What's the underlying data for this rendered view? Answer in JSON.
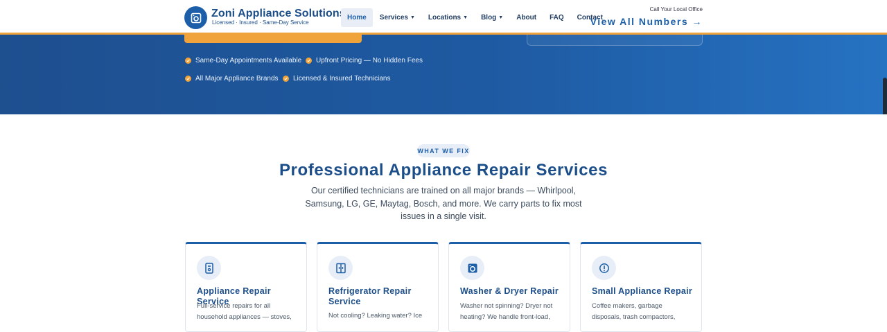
{
  "header": {
    "brand_name": "Zoni Appliance Solutions",
    "brand_tagline": "Licensed · Insured · Same-Day Service",
    "logo_icon": "washer-logo-icon",
    "nav": [
      {
        "label": "Home",
        "active": true,
        "has_caret": false
      },
      {
        "label": "Services",
        "active": false,
        "has_caret": true
      },
      {
        "label": "Locations",
        "active": false,
        "has_caret": true
      },
      {
        "label": "Blog",
        "active": false,
        "has_caret": true
      },
      {
        "label": "About",
        "active": false,
        "has_caret": false
      },
      {
        "label": "FAQ",
        "active": false,
        "has_caret": false
      },
      {
        "label": "Contact",
        "active": false,
        "has_caret": false
      }
    ],
    "call_label": "Call Your Local Office",
    "call_link": "View All Numbers →"
  },
  "hero": {
    "features": [
      "Same-Day Appointments Available",
      "Upfront Pricing — No Hidden Fees",
      "All Major Appliance Brands",
      "Licensed & Insured Technicians"
    ]
  },
  "services": {
    "eyebrow": "WHAT WE FIX",
    "title": "Professional Appliance Repair Services",
    "intro": "Our certified technicians are trained on all major brands — Whirlpool, Samsung, LG, GE, Maytag, Bosch, and more. We carry parts to fix most issues in a single visit.",
    "cards": [
      {
        "icon": "appliance-icon",
        "title": "Appliance Repair Service",
        "text": "Full-service repairs for all household appliances — stoves,"
      },
      {
        "icon": "refrigerator-icon",
        "title": "Refrigerator Repair Service",
        "text": "Not cooling? Leaking water? Ice"
      },
      {
        "icon": "washer-icon",
        "title": "Washer & Dryer Repair",
        "text": "Washer not spinning? Dryer not heating? We handle front-load,"
      },
      {
        "icon": "alert-icon",
        "title": "Small Appliance Repair",
        "text": "Coffee makers, garbage disposals, trash compactors,"
      }
    ]
  },
  "colors": {
    "brand_blue": "#1c5ea8",
    "accent_orange": "#f0a33a",
    "hero_start": "#1e4f8f",
    "hero_end": "#2672c2"
  }
}
